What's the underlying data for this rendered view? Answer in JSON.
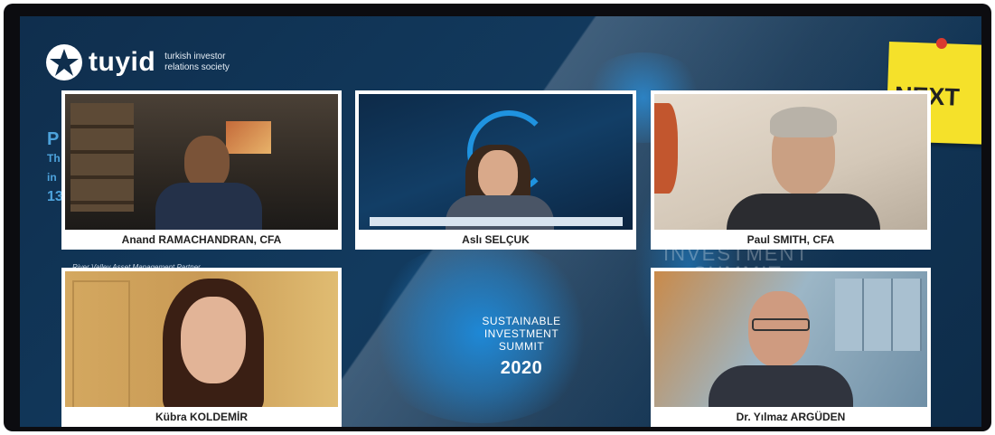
{
  "brand": {
    "name": "tuyid",
    "tagline_line1": "turkish investor",
    "tagline_line2": "relations society"
  },
  "sticky_note": {
    "label": "NEXT"
  },
  "event": {
    "line1": "SUSTAINABLE",
    "line2": "INVESTMENT",
    "line3": "SUMMIT",
    "year": "2020"
  },
  "side_fragments": [
    "P",
    "Th",
    "in",
    "13"
  ],
  "ghost_text": {
    "line1": "INVESTMENT",
    "line2": "SUMMIT"
  },
  "participants": [
    {
      "name": "Anand RAMACHANDRAN, CFA",
      "caption": "River Valley Asset Management Partner"
    },
    {
      "name": "Aslı SELÇUK"
    },
    {
      "name": "Paul SMITH, CFA"
    },
    {
      "name": "Kübra KOLDEMİR"
    },
    {
      "name": "Dr. Yılmaz ARGÜDEN"
    }
  ],
  "colors": {
    "background": "#0f2e4d",
    "accent_blue": "#1e88d6",
    "sticky_yellow": "#f5e12a",
    "tile_border": "#ffffff"
  }
}
